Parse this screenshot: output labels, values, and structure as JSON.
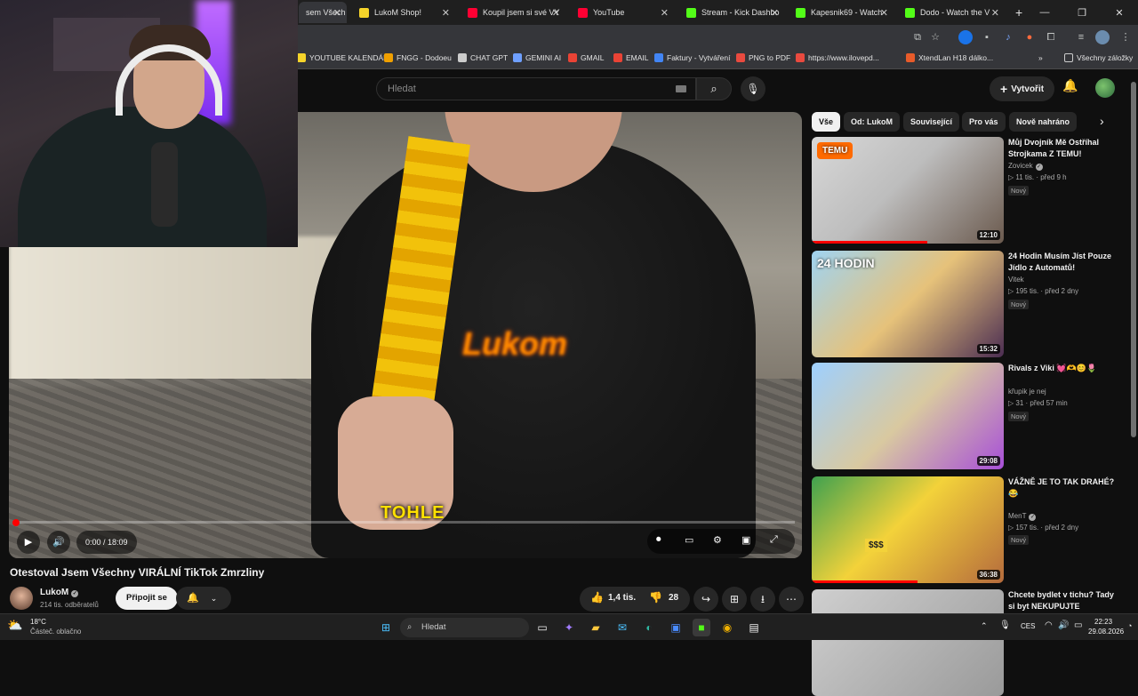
{
  "browser": {
    "tabs": [
      {
        "label": "sem Všech",
        "active": true,
        "color": "#e5e5e5"
      },
      {
        "label": "LukoM Shop!",
        "color": "#f6d42a"
      },
      {
        "label": "Koupil jsem si své VY",
        "color": "#ff0033"
      },
      {
        "label": "YouTube",
        "color": "#ff0033"
      },
      {
        "label": "Stream - Kick Dashbo",
        "color": "#53fc18"
      },
      {
        "label": "Kapesnik69 - Watch",
        "color": "#53fc18"
      },
      {
        "label": "Dodo - Watch the V",
        "color": "#53fc18"
      }
    ],
    "new_tab": "+",
    "bookmarks": [
      {
        "label": "YOUTUBE KALENDÁŘ",
        "color": "#f6d42a"
      },
      {
        "label": "FNGG - Dodoeu",
        "color": "#f0a000"
      },
      {
        "label": "CHAT GPT",
        "color": "#cccccc"
      },
      {
        "label": "GEMINI AI",
        "color": "#6fa0ff"
      },
      {
        "label": "GMAIL",
        "color": "#ea4335"
      },
      {
        "label": "EMAIL",
        "color": "#ea4335"
      },
      {
        "label": "Faktury - Vytváření",
        "color": "#4285f4"
      },
      {
        "label": "PNG to PDF",
        "color": "#e94a3f"
      },
      {
        "label": "https://www.ilovepd...",
        "color": "#e94a3f"
      },
      {
        "label": "XtendLan H18 dálko...",
        "color": "#e85b2a"
      }
    ],
    "all_bookmarks": "Všechny záložky"
  },
  "youtube": {
    "search_placeholder": "Hledat",
    "create_label": "Vytvořit",
    "video": {
      "title": "Otestoval Jsem Všechny VIRÁLNÍ TikTok Zmrzliny",
      "caption": "TOHLE",
      "hoodie_logo": "Lukom",
      "time": "0:00 / 18:09",
      "progress": 0.0
    },
    "channel": {
      "name": "LukoM",
      "subs": "214 tis. odběratelů",
      "join_label": "Připojit se"
    },
    "actions": {
      "likes": "1,4 tis.",
      "dislikes": "28"
    },
    "chips": [
      "Vše",
      "Od: LukoM",
      "Související",
      "Pro vás",
      "Nově nahráno"
    ],
    "recommendations": [
      {
        "title": "Můj Dvojník Mě Ostříhal Strojkama Z TEMU!",
        "channel": "Zovicek",
        "verified": true,
        "views": "11 tis.",
        "age": "před 9 h",
        "badge": "Nový",
        "duration": "12:10",
        "watched": 0.6,
        "thumb_text": "TEMU"
      },
      {
        "title": "24 Hodin Musím Jíst Pouze Jídlo z Automatů!",
        "channel": "Vitek",
        "verified": false,
        "views": "195 tis.",
        "age": "před 2 dny",
        "badge": "Nový",
        "duration": "15:32",
        "watched": 0.0,
        "thumb_text": "24 HODIN"
      },
      {
        "title": "Rivals z Viki 💓🫶😊🌷",
        "channel": "křupik je nej",
        "verified": false,
        "views": "31",
        "age": "před 57 min",
        "badge": "Nový",
        "duration": "29:08",
        "watched": 0.0,
        "thumb_text": ""
      },
      {
        "title": "VÁŽNĚ JE TO TAK DRAHÉ? 😂",
        "channel": "MenT",
        "verified": true,
        "views": "157 tis.",
        "age": "před 2 dny",
        "badge": "Nový",
        "duration": "36:38",
        "watched": 0.55,
        "thumb_text": "$$$"
      },
      {
        "title": "Chcete bydlet v tichu? Tady si byt NEKUPUJTE",
        "channel": "",
        "verified": false,
        "views": "",
        "age": "",
        "badge": "",
        "duration": "",
        "watched": 0.0,
        "thumb_text": ""
      }
    ]
  },
  "taskbar": {
    "weather_temp": "18°C",
    "weather_desc": "Částeč. oblačno",
    "search": "Hledat",
    "lang": "CES",
    "time": "22:23",
    "date": "29.08.2026"
  }
}
